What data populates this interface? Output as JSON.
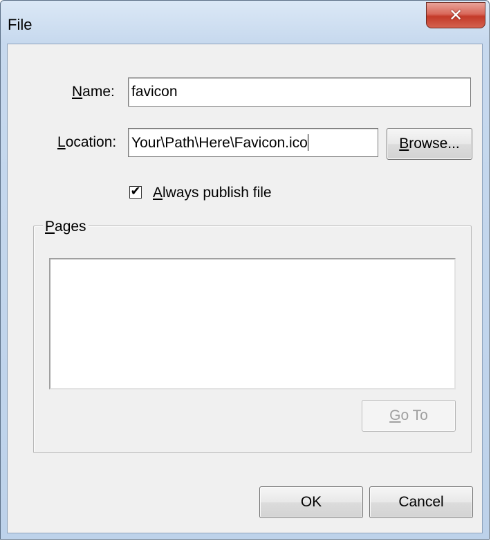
{
  "window": {
    "title": "File",
    "close_glyph": "✕"
  },
  "form": {
    "name_label_key": "N",
    "name_label_rest": "ame:",
    "name_value": "favicon",
    "location_label_key": "L",
    "location_label_rest": "ocation:",
    "location_value": "Your\\Path\\Here\\Favicon.ico",
    "browse_key": "B",
    "browse_rest": "rowse...",
    "always_publish_key": "A",
    "always_publish_rest": "lways publish file",
    "always_publish_checked": true,
    "checkmark": "✔"
  },
  "pages": {
    "caption_key": "P",
    "caption_rest": "ages",
    "items": [],
    "goto_key": "G",
    "goto_rest": "o To"
  },
  "footer": {
    "ok_label": "OK",
    "cancel_label": "Cancel"
  }
}
